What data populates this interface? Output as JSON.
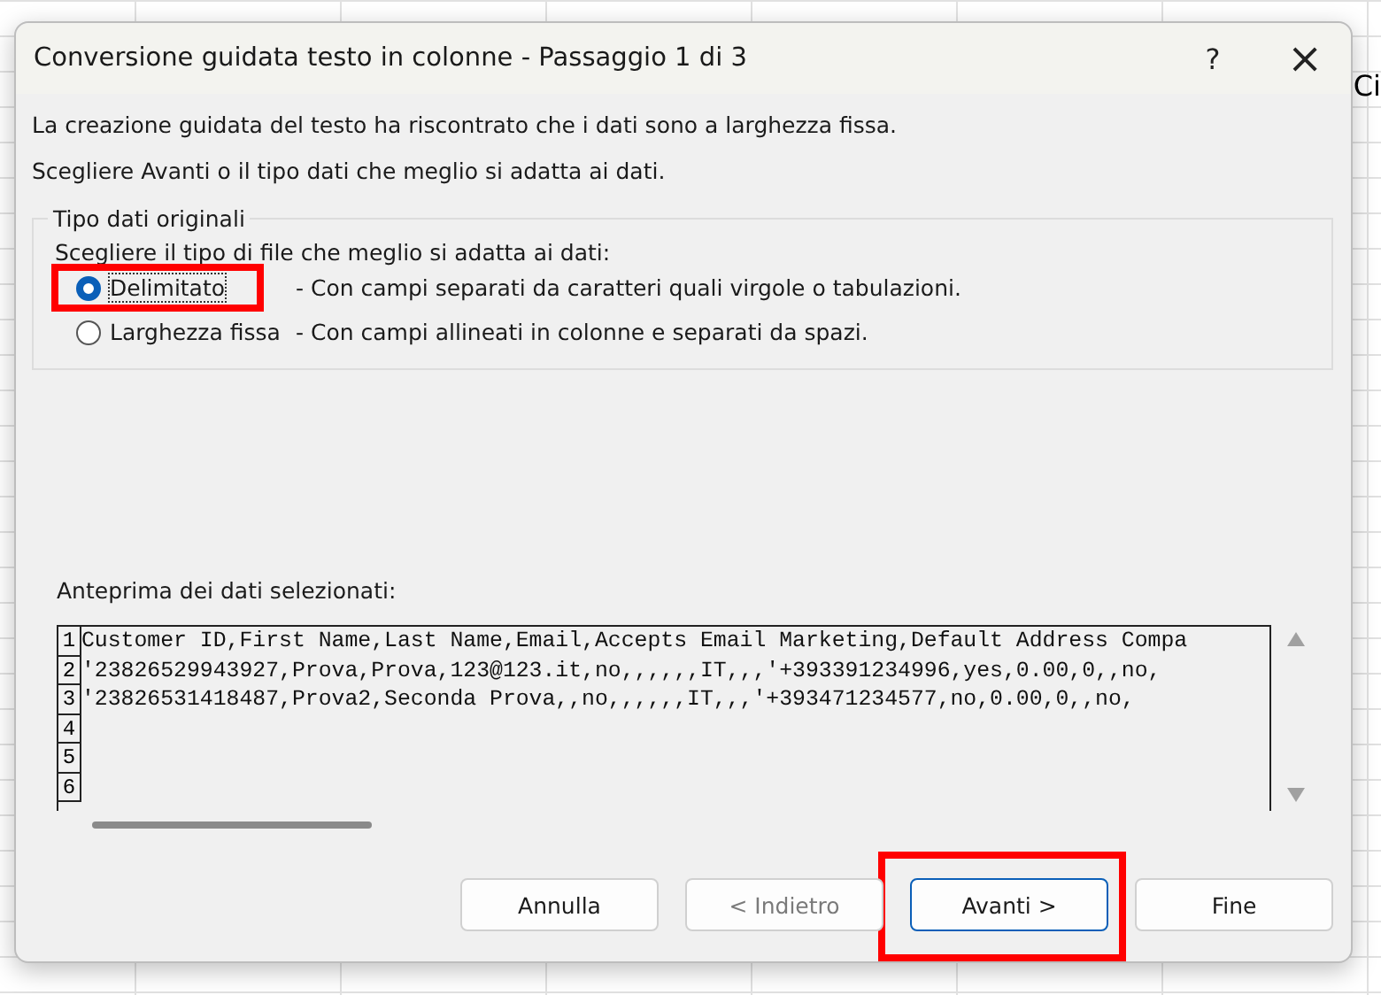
{
  "sheet": {
    "right_cells": [
      "Ci"
    ]
  },
  "window": {
    "title": "Conversione guidata testo in colonne - Passaggio 1 di 3",
    "help": "?",
    "close": "×"
  },
  "intro": [
    "La creazione guidata del testo ha riscontrato che i dati sono a larghezza fissa.",
    "Scegliere Avanti o il tipo dati che meglio si adatta ai dati."
  ],
  "group": {
    "title": "Tipo dati originali",
    "prompt": "Scegliere il tipo di file che meglio si adatta ai dati:",
    "options": [
      {
        "label": "Delimitato",
        "description": "- Con campi separati da caratteri quali virgole o tabulazioni.",
        "selected": true,
        "highlighted": true
      },
      {
        "label": "Larghezza fissa",
        "description": "- Con campi allineati in colonne e separati da spazi.",
        "selected": false,
        "highlighted": false
      }
    ]
  },
  "preview": {
    "label": "Anteprima dei dati selezionati:",
    "rows": [
      {
        "number": "1",
        "text": "Customer ID,First Name,Last Name,Email,Accepts Email Marketing,Default Address Compa"
      },
      {
        "number": "2",
        "text": "'23826529943927,Prova,Prova,123@123.it,no,,,,,,IT,,,'+393391234996,yes,0.00,0,,no,"
      },
      {
        "number": "3",
        "text": "'23826531418487,Prova2,Seconda Prova,,no,,,,,,IT,,,'+393471234577,no,0.00,0,,no,"
      },
      {
        "number": "4",
        "text": ""
      },
      {
        "number": "5",
        "text": ""
      },
      {
        "number": "6",
        "text": ""
      }
    ]
  },
  "buttons": [
    {
      "label": "Annulla",
      "disabled": false,
      "default": false,
      "highlighted": false
    },
    {
      "label": "< Indietro",
      "disabled": true,
      "default": false,
      "highlighted": false
    },
    {
      "label": "Avanti >",
      "disabled": false,
      "default": true,
      "highlighted": true
    },
    {
      "label": "Fine",
      "disabled": false,
      "default": false,
      "highlighted": false
    }
  ]
}
